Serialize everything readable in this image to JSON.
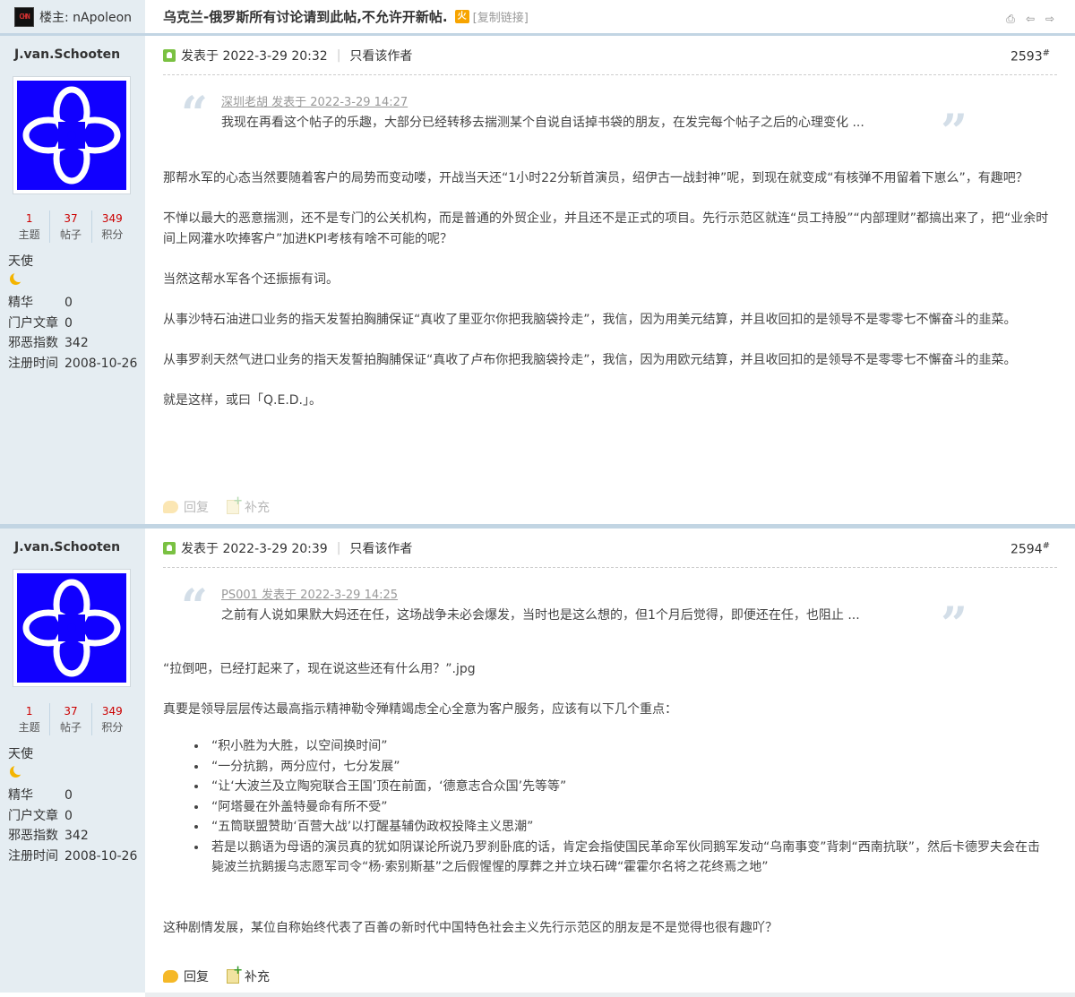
{
  "header": {
    "owner_label": "楼主: nApoleon",
    "owner_icon_text": "CHN",
    "thread_title": "乌克兰-俄罗斯所有讨论请到此帖,不允许开新帖.",
    "hot_badge": "火",
    "copy_link": "[复制链接]"
  },
  "author": {
    "name": "J.van.Schooten",
    "stats": [
      {
        "num": "1",
        "label": "主题"
      },
      {
        "num": "37",
        "label": "帖子"
      },
      {
        "num": "349",
        "label": "积分"
      }
    ],
    "rank": "天使",
    "profile": [
      {
        "key": "精华",
        "value": "0"
      },
      {
        "key": "门户文章",
        "value": "0"
      },
      {
        "key": "邪恶指数",
        "value": "342"
      },
      {
        "key": "注册时间",
        "value": "2008-10-26"
      }
    ]
  },
  "posts": [
    {
      "posted": "发表于 2022-3-29 20:32",
      "only_author": "只看该作者",
      "floor": "2593",
      "quote_source": "深圳老胡 发表于 2022-3-29 14:27",
      "quote_text": "我现在再看这个帖子的乐趣，大部分已经转移去揣测某个自说自话掉书袋的朋友，在发完每个帖子之后的心理变化 ...",
      "paragraphs": [
        "那帮水军的心态当然要随着客户的局势而变动喽，开战当天还“1小时22分斩首演员，绍伊古一战封神”呢，到现在就变成“有核弹不用留着下崽么”，有趣吧？",
        "不惮以最大的恶意揣测，还不是专门的公关机构，而是普通的外贸企业，并且还不是正式的项目。先行示范区就连“员工持股”“内部理财”都搞出来了，把“业余时间上网灌水吹捧客户”加进KPI考核有啥不可能的呢？",
        "当然这帮水军各个还振振有词。",
        "从事沙特石油进口业务的指天发誓拍胸脯保证“真收了里亚尔你把我脑袋拎走”，我信，因为用美元结算，并且收回扣的是领导不是零零七不懈奋斗的韭菜。",
        "从事罗刹天然气进口业务的指天发誓拍胸脯保证“真收了卢布你把我脑袋拎走”，我信，因为用欧元结算，并且收回扣的是领导不是零零七不懈奋斗的韭菜。",
        "就是这样，或曰「Q.E.D.」。"
      ],
      "reply": "回复",
      "supplement": "补充"
    },
    {
      "posted": "发表于 2022-3-29 20:39",
      "only_author": "只看该作者",
      "floor": "2594",
      "quote_source": "PS001 发表于 2022-3-29 14:25",
      "quote_text": "之前有人说如果默大妈还在任，这场战争未必会爆发，当时也是这么想的，但1个月后觉得，即便还在任，也阻止 ...",
      "paragraph1": "“拉倒吧，已经打起来了，现在说这些还有什么用？”.jpg",
      "paragraph2": "真要是领导层层传达最高指示精神勒令殚精竭虑全心全意为客户服务，应该有以下几个重点：",
      "bullets": [
        "“积小胜为大胜，以空间换时间”",
        "“一分抗鹅，两分应付，七分发展”",
        "“让‘大波兰及立陶宛联合王国’顶在前面，‘德意志合众国’先等等”",
        "“阿塔曼在外盖特曼命有所不受”",
        "“五筒联盟赞助‘百营大战’以打醒基辅伪政权投降主义思潮”",
        "若是以鹅语为母语的演员真的犹如阴谋论所说乃罗刹卧底的话，肯定会指使国民革命军伙同鹅军发动“乌南事变”背刺“西南抗联”，然后卡德罗夫会在击毙波兰抗鹅援乌志愿军司令“杨·索别斯基”之后假惺惺的厚葬之并立块石碑“霍霍尔名将之花终焉之地”"
      ],
      "paragraph3": "这种剧情发展，某位自称始终代表了百善の新时代中国特色社会主义先行示范区的朋友是不是觉得也很有趣吖？",
      "reply": "回复",
      "supplement": "补充"
    }
  ]
}
